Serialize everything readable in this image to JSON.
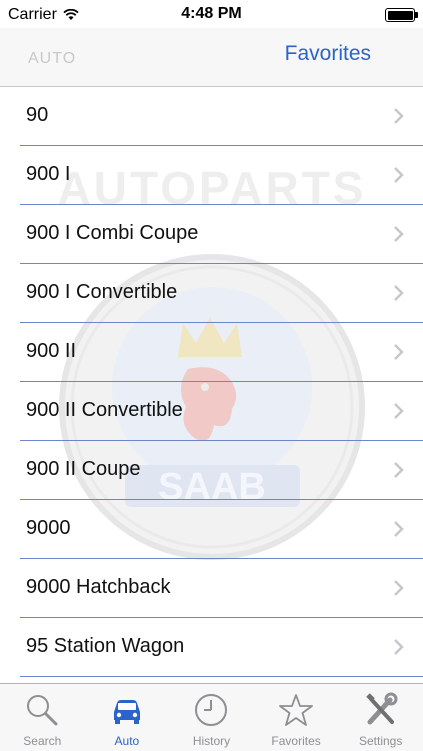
{
  "status_bar": {
    "carrier": "Carrier",
    "time": "4:48 PM",
    "battery_level": 1.0
  },
  "nav": {
    "ghost_text": "AUTO",
    "right_button": "Favorites"
  },
  "watermark": {
    "brand_text": "AUTOPARTS",
    "logo_text": "SAAB"
  },
  "list": {
    "items": [
      {
        "label": "90"
      },
      {
        "label": "900 I"
      },
      {
        "label": "900 I Combi Coupe"
      },
      {
        "label": "900 I Convertible"
      },
      {
        "label": "900 II"
      },
      {
        "label": "900 II Convertible"
      },
      {
        "label": "900 II Coupe"
      },
      {
        "label": "9000"
      },
      {
        "label": "9000 Hatchback"
      },
      {
        "label": "95 Station Wagon"
      }
    ]
  },
  "tab_bar": {
    "tabs": [
      {
        "label": "Search",
        "icon": "search-icon"
      },
      {
        "label": "Auto",
        "icon": "car-icon",
        "active": true
      },
      {
        "label": "History",
        "icon": "clock-icon"
      },
      {
        "label": "Favorites",
        "icon": "star-icon"
      },
      {
        "label": "Settings",
        "icon": "tools-icon"
      }
    ]
  },
  "colors": {
    "accent": "#2c63c8",
    "separator": "#6e86c9",
    "inactive_tab": "#8e8e93"
  }
}
